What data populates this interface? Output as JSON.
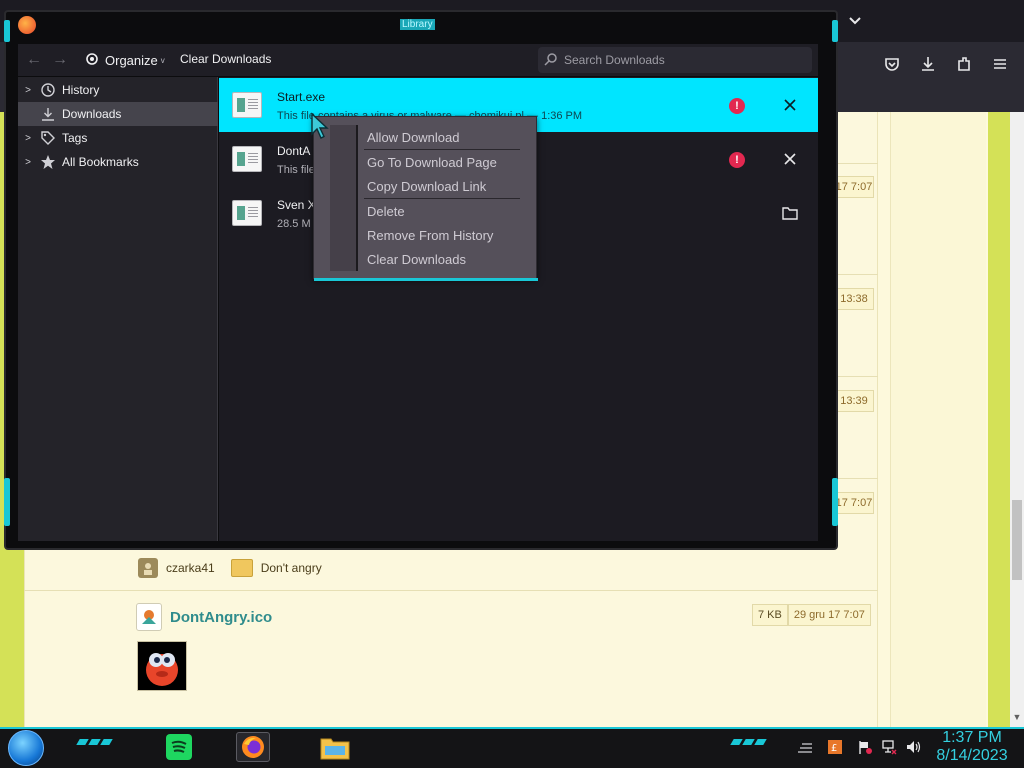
{
  "library": {
    "title": "Library",
    "toolbar": {
      "organize_label": "Organize",
      "clear_downloads_label": "Clear Downloads",
      "search_placeholder": "Search Downloads"
    },
    "sidebar": {
      "items": [
        {
          "label": "History"
        },
        {
          "label": "Downloads"
        },
        {
          "label": "Tags"
        },
        {
          "label": "All Bookmarks"
        }
      ]
    },
    "downloads": [
      {
        "title": "Start.exe",
        "status": "This file contains a virus or malware — chomikuj.pl — 1:36 PM"
      },
      {
        "title": "DontA",
        "status": "This file — 1:36 PM"
      },
      {
        "title": "Sven X",
        "status": "28.5 M"
      }
    ]
  },
  "context_menu": {
    "items": [
      {
        "label": "Allow Download"
      },
      {
        "label": "Go To Download Page"
      },
      {
        "label": "Copy Download Link"
      },
      {
        "label": "Delete"
      },
      {
        "label": "Remove From History"
      },
      {
        "label": "Clear Downloads"
      }
    ]
  },
  "page": {
    "timestamps": [
      "17 7:07",
      "13:38",
      "13:39",
      "17 7:07"
    ],
    "user": "czarka41",
    "folder": "Don't angry",
    "file": {
      "name": "DontAngry.ico",
      "size": "7 KB",
      "date": "29 gru 17 7:07"
    }
  },
  "taskbar": {
    "time": "1:37 PM",
    "date": "8/14/2023"
  },
  "colors": {
    "accent": "#19c7d6",
    "selected_row": "#00e5ff",
    "warning": "#e22850",
    "page_green": "#d4e157",
    "link_teal": "#2f8c8c"
  }
}
